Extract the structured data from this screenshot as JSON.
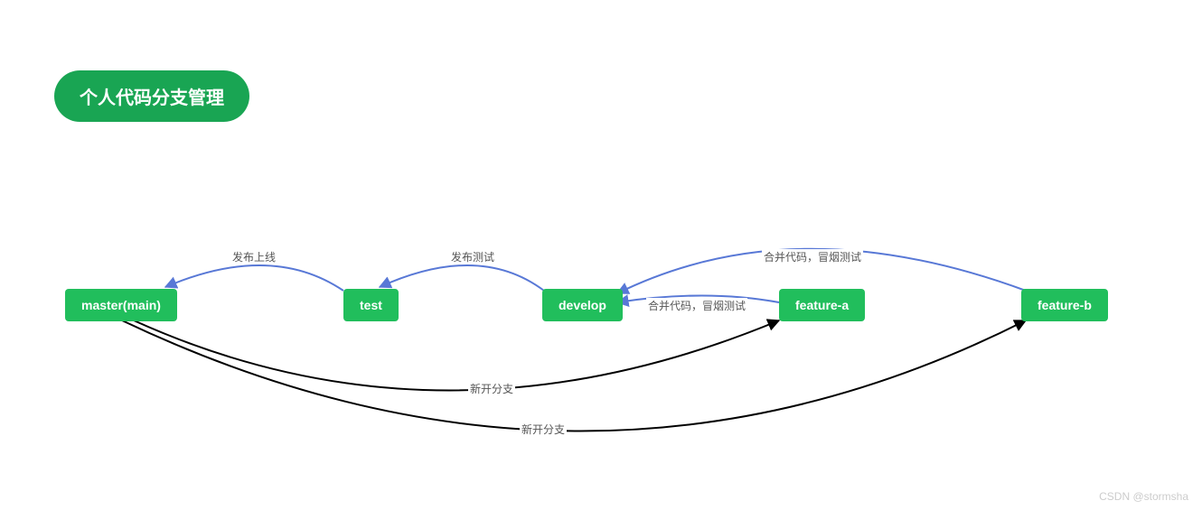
{
  "title": "个人代码分支管理",
  "nodes": {
    "master": "master(main)",
    "test": "test",
    "develop": "develop",
    "feature_a": "feature-a",
    "feature_b": "feature-b"
  },
  "labels": {
    "publish_online": "发布上线",
    "publish_test": "发布测试",
    "merge_smoke_a": "合并代码，冒烟测试",
    "merge_smoke_b": "合并代码，冒烟测试",
    "new_branch_a": "新开分支",
    "new_branch_b": "新开分支"
  },
  "watermark": "CSDN @stormsha",
  "colors": {
    "node": "#21be5c",
    "arrow_blue": "#5878d6",
    "arrow_black": "#000000"
  }
}
